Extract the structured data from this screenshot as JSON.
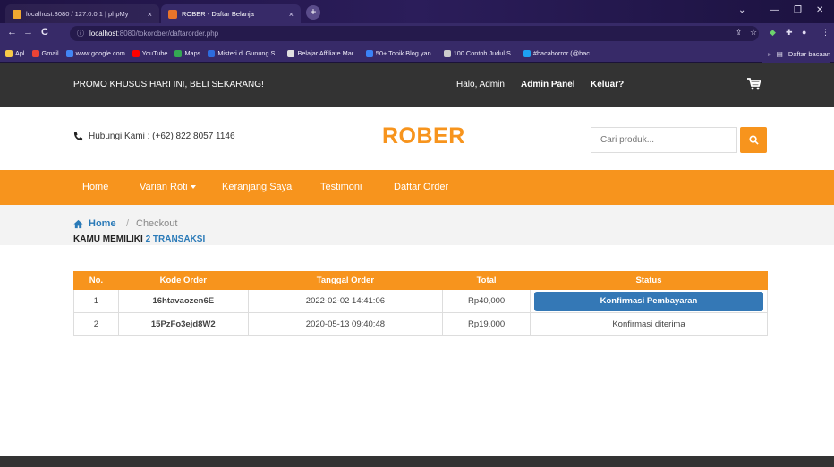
{
  "browser": {
    "tab_inactive_title": "localhost:8080 / 127.0.0.1 | phpMy",
    "tab_active_title": "ROBER - Daftar Belanja",
    "tab_close": "×",
    "new_tab": "+",
    "url_host": "localhost",
    "url_rest": ":8080/tokorober/daftarorder.php",
    "bookmarks": [
      {
        "label": "Apl",
        "color": "#f7c948"
      },
      {
        "label": "Gmail",
        "color": "#ea4335"
      },
      {
        "label": "www.google.com",
        "color": "#4285f4"
      },
      {
        "label": "YouTube",
        "color": "#ff0000"
      },
      {
        "label": "Maps",
        "color": "#34a853"
      },
      {
        "label": "Misteri di Gunung S...",
        "color": "#2d6cdf"
      },
      {
        "label": "Belajar Affiliate Mar...",
        "color": "#e0e0e0"
      },
      {
        "label": "50+ Topik Blog yan...",
        "color": "#3b82f6"
      },
      {
        "label": "100 Contoh Judul S...",
        "color": "#cccccc"
      },
      {
        "label": "#bacahorror (@bac...",
        "color": "#1da1f2"
      }
    ],
    "bookmark_more": "»",
    "reading_list": "Daftar bacaan"
  },
  "topbar": {
    "promo": "PROMO KHUSUS HARI INI, BELI SEKARANG!",
    "greeting": "Halo, Admin",
    "admin_panel": "Admin Panel",
    "logout": "Keluar?"
  },
  "header": {
    "contact": "Hubungi Kami : (+62) 822 8057 1146",
    "logo": "ROBER",
    "search_placeholder": "Cari produk..."
  },
  "nav": {
    "items": [
      "Home",
      "Varian Roti",
      "Keranjang Saya",
      "Testimoni",
      "Daftar Order"
    ]
  },
  "breadcrumb": {
    "home": "Home",
    "separator": "/",
    "current": "Checkout"
  },
  "orders": {
    "heading_prefix": "KAMU MEMILIKI",
    "heading_count": "2",
    "heading_suffix": "TRANSAKSI",
    "columns": [
      "No.",
      "Kode Order",
      "Tanggal Order",
      "Total",
      "Status"
    ],
    "rows": [
      {
        "no": "1",
        "code": "16htavaozen6E",
        "date": "2022-02-02 14:41:06",
        "total": "Rp40,000",
        "status": "Konfirmasi Pembayaran",
        "status_is_button": true
      },
      {
        "no": "2",
        "code": "15PzFo3ejd8W2",
        "date": "2020-05-13 09:40:48",
        "total": "Rp19,000",
        "status": "Konfirmasi diterima",
        "status_is_button": false
      }
    ]
  },
  "colors": {
    "accent": "#f7941d",
    "link": "#2a7ab8",
    "button": "#3478b6",
    "dark": "#333333"
  }
}
